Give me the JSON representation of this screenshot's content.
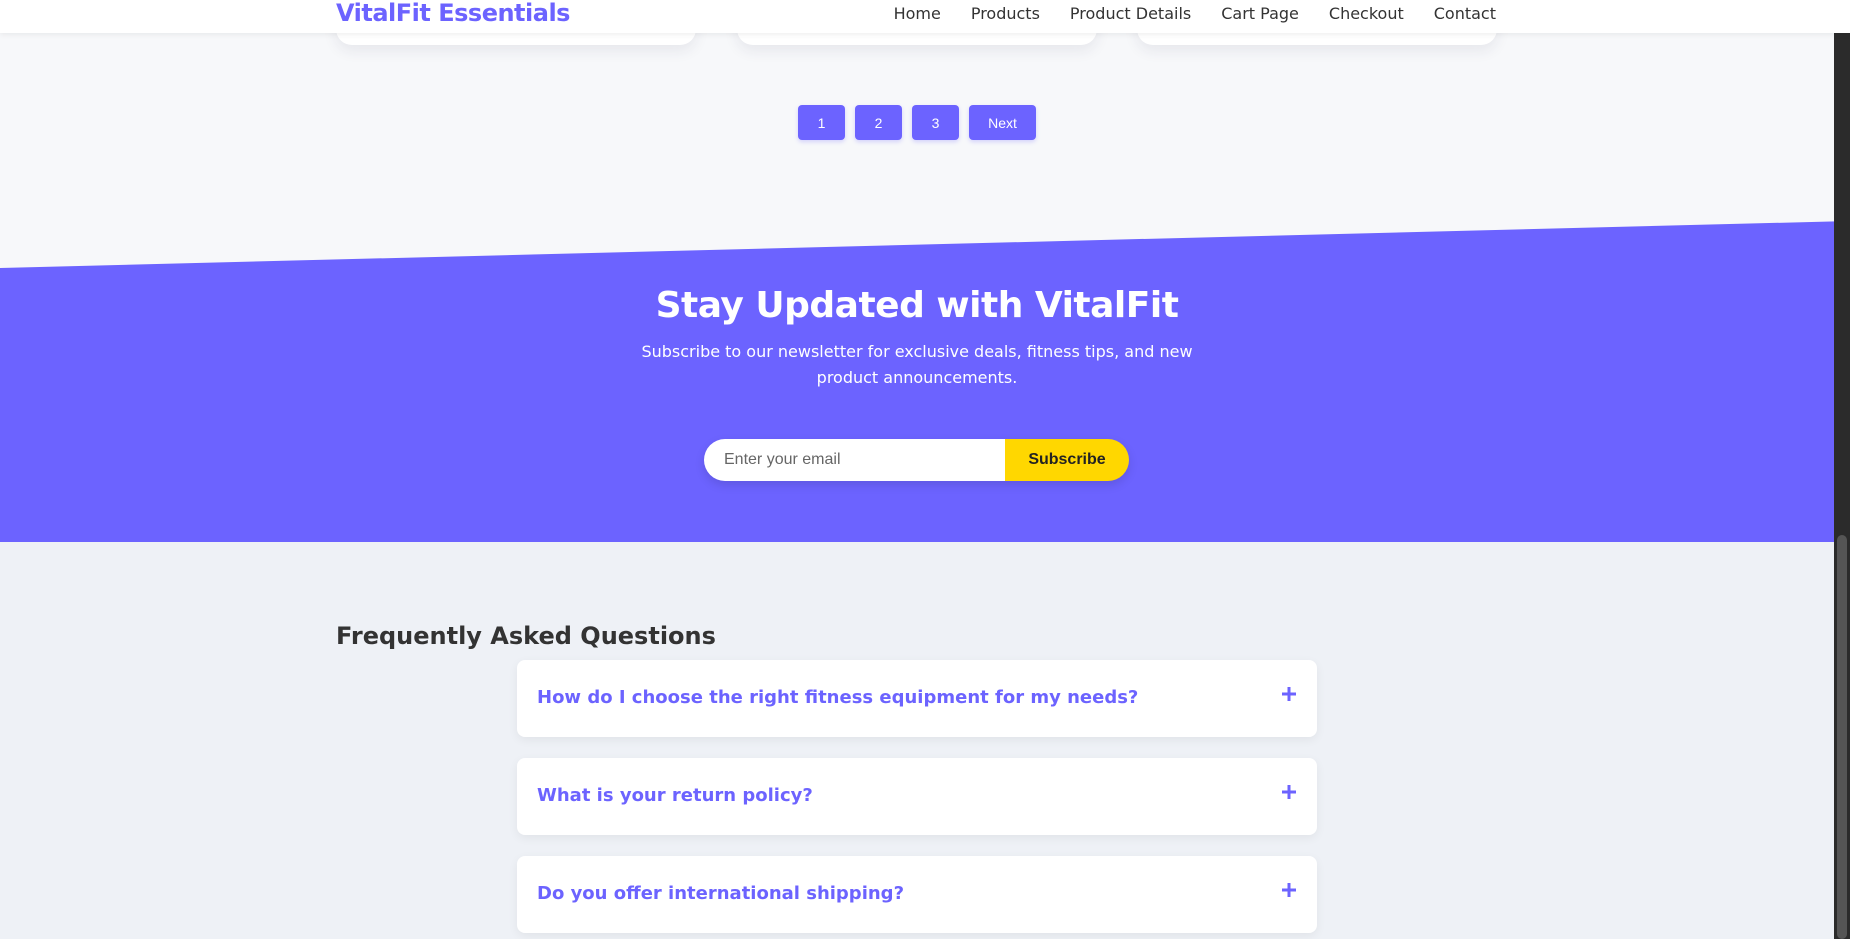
{
  "header": {
    "brand": "VitalFit Essentials",
    "nav": [
      "Home",
      "Products",
      "Product Details",
      "Cart Page",
      "Checkout",
      "Contact"
    ]
  },
  "pagination": {
    "pages": [
      "1",
      "2",
      "3"
    ],
    "next_label": "Next"
  },
  "newsletter": {
    "title": "Stay Updated with VitalFit",
    "description": "Subscribe to our newsletter for exclusive deals, fitness tips, and new product announcements.",
    "email_placeholder": "Enter your email",
    "subscribe_label": "Subscribe"
  },
  "faq": {
    "title": "Frequently Asked Questions",
    "items": [
      {
        "question": "How do I choose the right fitness equipment for my needs?"
      },
      {
        "question": "What is your return policy?"
      },
      {
        "question": "Do you offer international shipping?"
      }
    ],
    "toggle_icon": "plus-icon"
  },
  "colors": {
    "accent": "#6c63ff",
    "button_yellow": "#ffd700",
    "page_bg": "#f7f8fa",
    "faq_bg": "#eef1f6"
  }
}
